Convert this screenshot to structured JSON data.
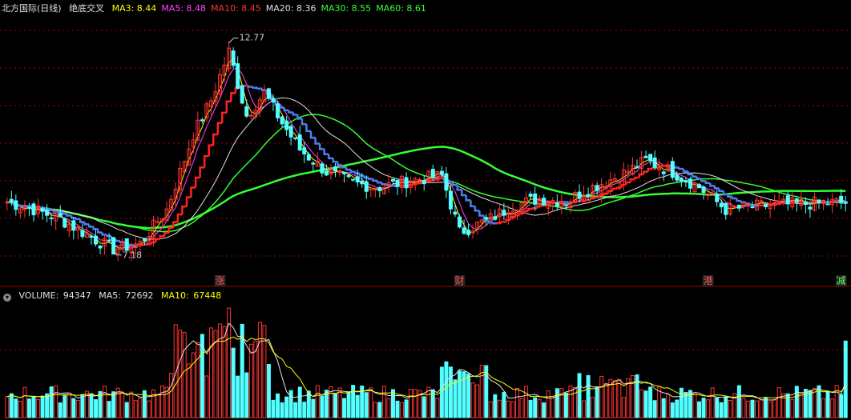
{
  "header": {
    "title": "北方国际(日线)",
    "indicator_name": "绝底交叉",
    "ma_items": [
      {
        "label": "MA3:",
        "value": "8.44",
        "color": "#ffff00"
      },
      {
        "label": "MA5:",
        "value": "8.48",
        "color": "#ff44ff"
      },
      {
        "label": "MA10:",
        "value": "8.45",
        "color": "#ff3333"
      },
      {
        "label": "MA20:",
        "value": "8.36",
        "color": "#e0e0e0"
      },
      {
        "label": "MA30:",
        "value": "8.55",
        "color": "#33ff33"
      },
      {
        "label": "MA60:",
        "value": "8.61",
        "color": "#33ff33"
      }
    ]
  },
  "volume_header": {
    "title": "VOLUME:",
    "value": "94347",
    "ma5_label": "MA5:",
    "ma5_value": "72692",
    "ma10_label": "MA10:",
    "ma10_value": "67448"
  },
  "annotations": {
    "high_label": "12.77",
    "low_label": "7.18"
  },
  "markers": [
    {
      "text": "涨",
      "index": 48
    },
    {
      "text": "财",
      "index": 102
    },
    {
      "text": "港",
      "index": 158
    },
    {
      "text": "减",
      "index": 188
    }
  ],
  "colors": {
    "up": "#ff3333",
    "down": "#54ffff",
    "ma_yellow": "#ffff00",
    "ma_white": "#e0e0e0",
    "ma_green": "#33ff33",
    "ma_red": "#ff2222",
    "blue_step": "#4d7ff0",
    "grid": "#aa0000"
  },
  "chart_data": {
    "type": "candlestick",
    "price_range": [
      6.6,
      13.4
    ],
    "bar_count": 190,
    "high": 12.77,
    "low": 7.18,
    "anchors": [
      [
        0,
        8.5
      ],
      [
        5,
        8.35
      ],
      [
        12,
        8.05
      ],
      [
        20,
        7.5
      ],
      [
        24,
        7.25
      ],
      [
        30,
        7.4
      ],
      [
        36,
        8.3
      ],
      [
        42,
        10.3
      ],
      [
        46,
        11.2
      ],
      [
        50,
        12.5
      ],
      [
        54,
        10.8
      ],
      [
        58,
        11.4
      ],
      [
        62,
        10.6
      ],
      [
        66,
        9.9
      ],
      [
        72,
        9.3
      ],
      [
        78,
        9.0
      ],
      [
        84,
        8.9
      ],
      [
        92,
        9.1
      ],
      [
        98,
        9.2
      ],
      [
        102,
        7.7
      ],
      [
        108,
        8.0
      ],
      [
        114,
        8.4
      ],
      [
        120,
        8.6
      ],
      [
        126,
        8.5
      ],
      [
        130,
        8.8
      ],
      [
        138,
        9.2
      ],
      [
        144,
        9.6
      ],
      [
        150,
        9.3
      ],
      [
        156,
        8.9
      ],
      [
        162,
        8.3
      ],
      [
        170,
        8.4
      ],
      [
        178,
        8.45
      ],
      [
        189,
        8.5
      ]
    ],
    "volume_range": [
      0,
      140000
    ],
    "volume": {
      "last": 94347,
      "ma5": 72692,
      "ma10": 67448
    }
  }
}
